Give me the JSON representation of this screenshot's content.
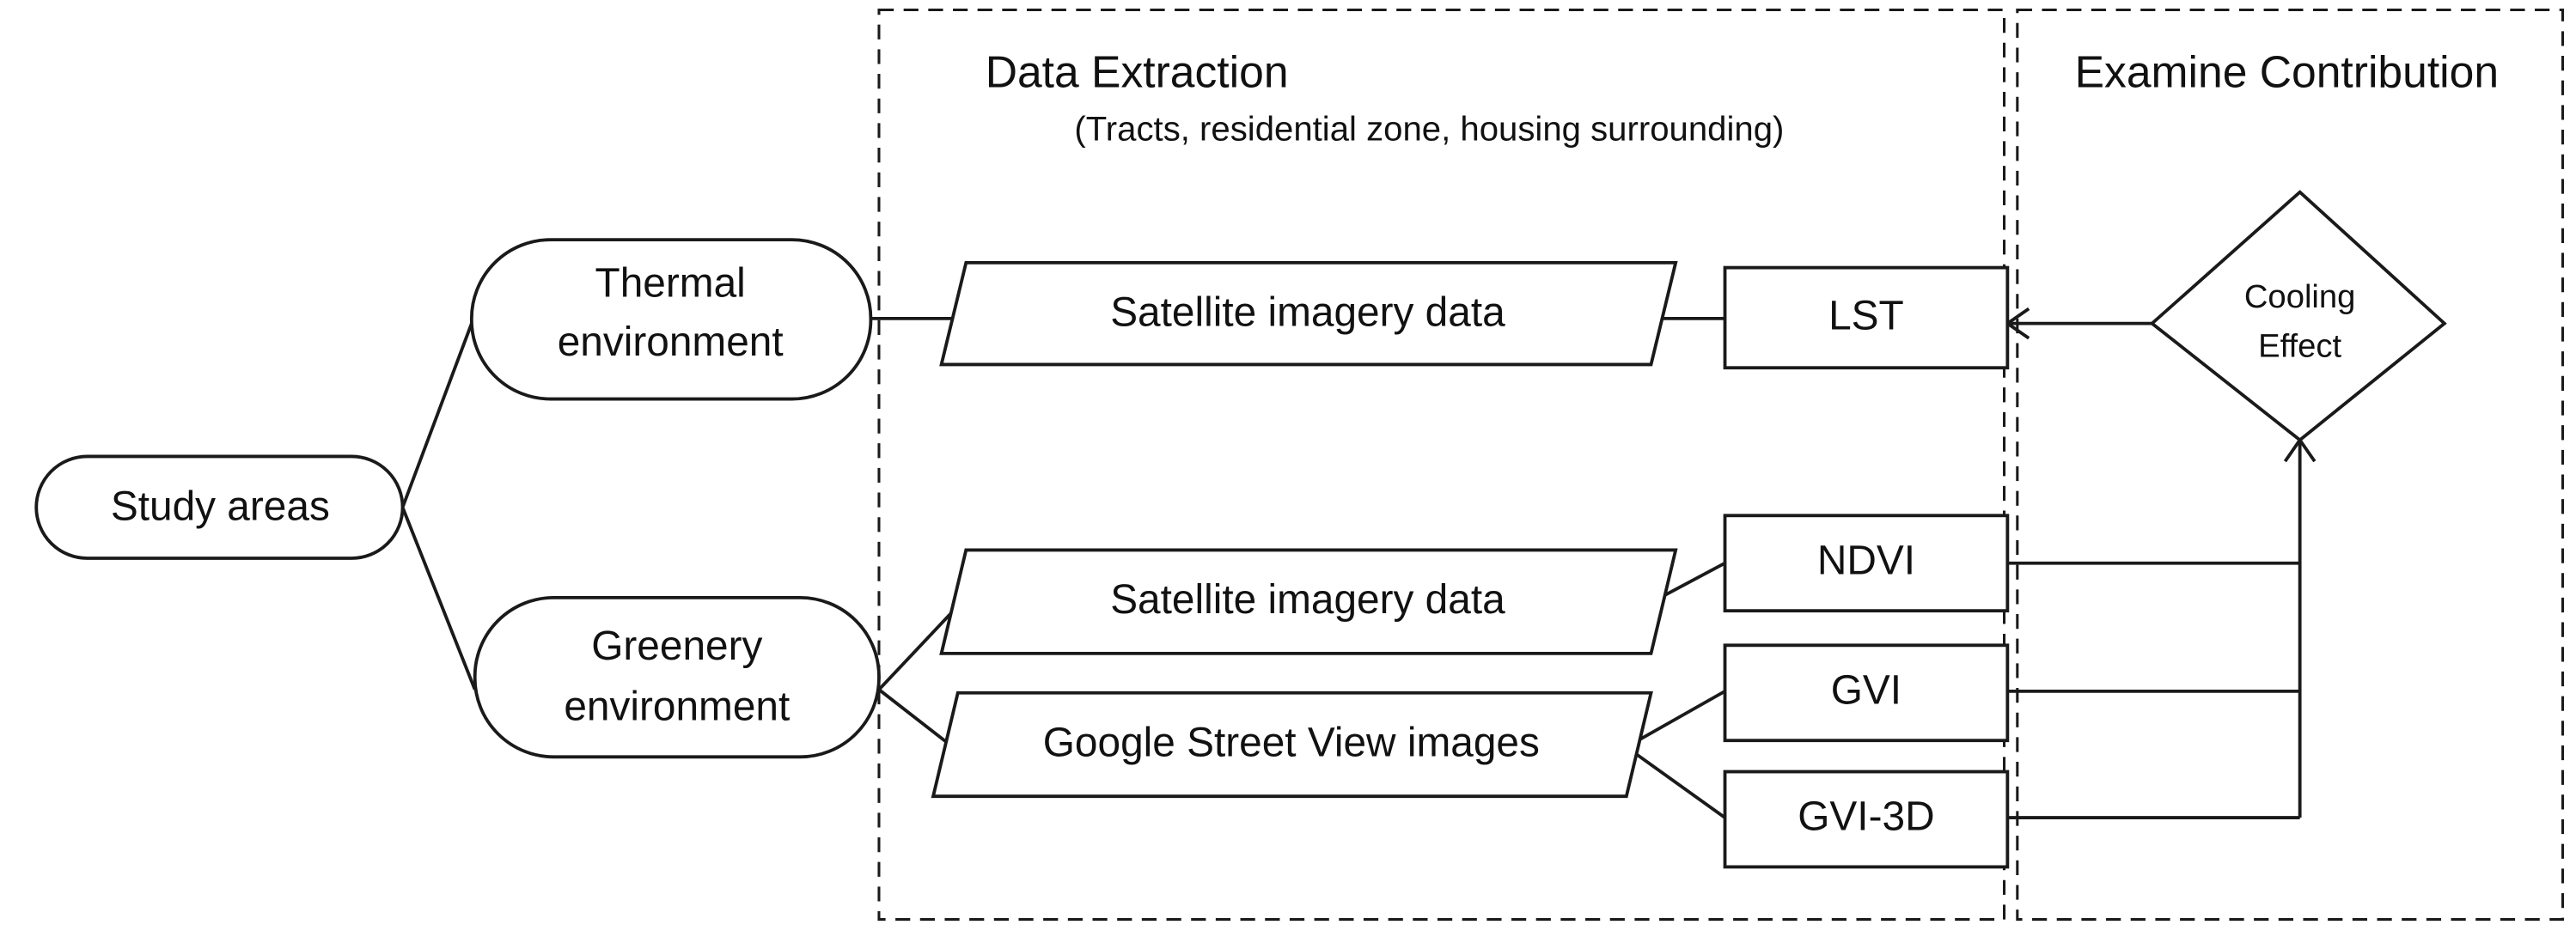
{
  "sections": {
    "data_extraction": {
      "title": "Data Extraction",
      "subtitle": "(Tracts, residential zone, housing surrounding)"
    },
    "examine_contribution": {
      "title": "Examine Contribution"
    }
  },
  "nodes": {
    "study_areas": "Study areas",
    "thermal_line1": "Thermal",
    "thermal_line2": "environment",
    "greenery_line1": "Greenery",
    "greenery_line2": "environment",
    "satellite_thermal": "Satellite imagery data",
    "satellite_greenery": "Satellite imagery data",
    "gsv": "Google Street View images",
    "lst": "LST",
    "ndvi": "NDVI",
    "gvi": "GVI",
    "gvi3d": "GVI-3D",
    "cooling_line1": "Cooling",
    "cooling_line2": "Effect"
  }
}
